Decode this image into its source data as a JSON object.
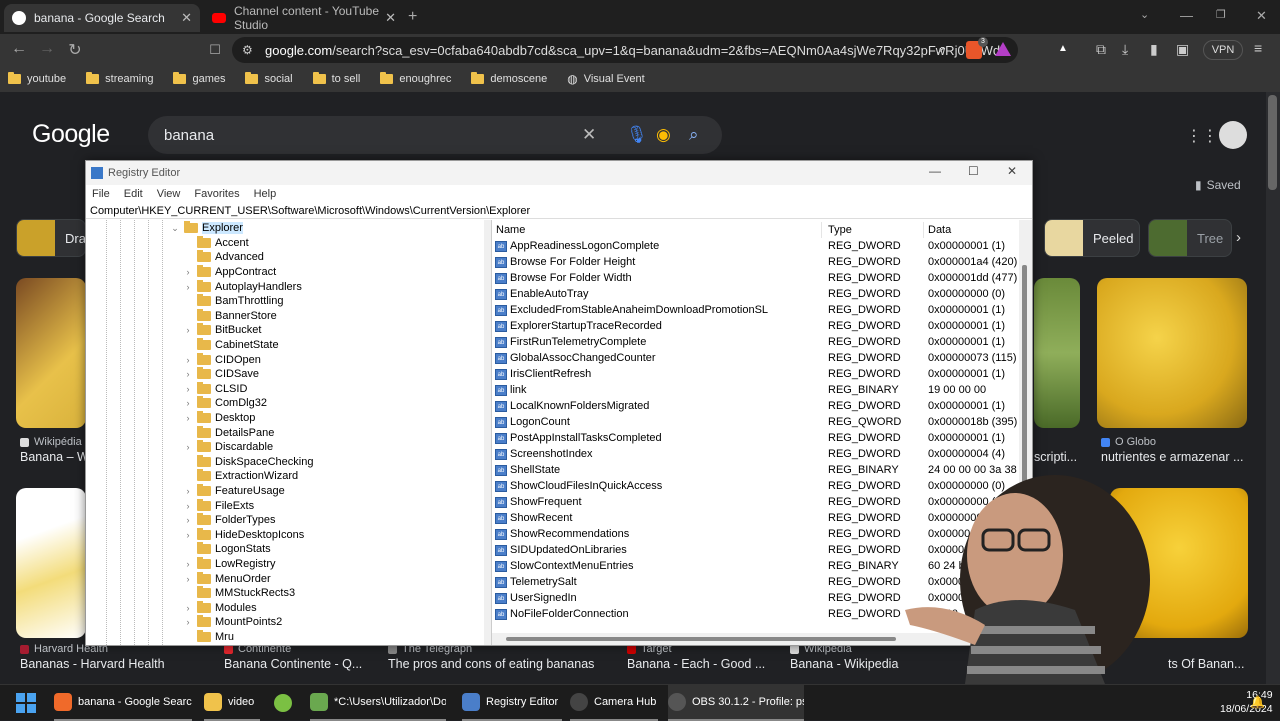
{
  "browser": {
    "tabs": [
      {
        "title": "banana - Google Search",
        "active": true,
        "color": "#ffffff"
      },
      {
        "title": "Channel content - YouTube Studio",
        "active": false,
        "color": "#ff0000"
      }
    ],
    "url_host": "google.com",
    "url_rest": "/search?sca_esv=0cfaba640abdb7cd&sca_upv=1&q=banana&udm=2&fbs=AEQNm0Aa4sjWe7Rqy32pFwRj0UkWd...",
    "brave_badge": "3",
    "vpn": "VPN",
    "bookmarks": [
      "youtube",
      "streaming",
      "games",
      "social",
      "to sell",
      "enoughrec",
      "demoscene",
      "Visual Event"
    ]
  },
  "google": {
    "logo": "Google",
    "query": "banana",
    "saved": "Saved",
    "chips": [
      "Dra",
      "Peeled",
      "Tree"
    ],
    "results": [
      {
        "source": "Wikipédia",
        "title": "Banana – W",
        "color": "#8b5a2b"
      },
      {
        "source": "O Globo",
        "title": "nutrientes e armazenar ...",
        "color": "#caa12a"
      },
      {
        "source": "",
        "title": "scripti...",
        "color": "#6a8a3a"
      },
      {
        "source": "Harvard Health",
        "title": "Bananas - Harvard Health"
      },
      {
        "source": "Continente",
        "title": "Banana Continente - Q..."
      },
      {
        "source": "The Telegraph",
        "title": "The pros and cons of eating bananas"
      },
      {
        "source": "Target",
        "title": "Banana - Each - Good ..."
      },
      {
        "source": "Wikipedia",
        "title": "Banana - Wikipedia"
      },
      {
        "source": "",
        "title": "ts Of Banan..."
      }
    ]
  },
  "regedit": {
    "title": "Registry Editor",
    "menu": [
      "File",
      "Edit",
      "View",
      "Favorites",
      "Help"
    ],
    "address": "Computer\\HKEY_CURRENT_USER\\Software\\Microsoft\\Windows\\CurrentVersion\\Explorer",
    "tree_root": "Explorer",
    "tree": [
      {
        "label": "Accent",
        "arrow": false
      },
      {
        "label": "Advanced",
        "arrow": false
      },
      {
        "label": "AppContract",
        "arrow": true
      },
      {
        "label": "AutoplayHandlers",
        "arrow": true
      },
      {
        "label": "BamThrottling",
        "arrow": false
      },
      {
        "label": "BannerStore",
        "arrow": false
      },
      {
        "label": "BitBucket",
        "arrow": true
      },
      {
        "label": "CabinetState",
        "arrow": false
      },
      {
        "label": "CIDOpen",
        "arrow": true
      },
      {
        "label": "CIDSave",
        "arrow": true
      },
      {
        "label": "CLSID",
        "arrow": true
      },
      {
        "label": "ComDlg32",
        "arrow": true
      },
      {
        "label": "Desktop",
        "arrow": true
      },
      {
        "label": "DetailsPane",
        "arrow": false
      },
      {
        "label": "Discardable",
        "arrow": true
      },
      {
        "label": "DiskSpaceChecking",
        "arrow": false
      },
      {
        "label": "ExtractionWizard",
        "arrow": false
      },
      {
        "label": "FeatureUsage",
        "arrow": true
      },
      {
        "label": "FileExts",
        "arrow": true
      },
      {
        "label": "FolderTypes",
        "arrow": true
      },
      {
        "label": "HideDesktopIcons",
        "arrow": true
      },
      {
        "label": "LogonStats",
        "arrow": false
      },
      {
        "label": "LowRegistry",
        "arrow": true
      },
      {
        "label": "MenuOrder",
        "arrow": true
      },
      {
        "label": "MMStuckRects3",
        "arrow": false
      },
      {
        "label": "Modules",
        "arrow": true
      },
      {
        "label": "MountPoints2",
        "arrow": true
      },
      {
        "label": "Mru",
        "arrow": false
      }
    ],
    "columns": [
      "Name",
      "Type",
      "Data"
    ],
    "values": [
      {
        "name": "AppReadinessLogonComplete",
        "type": "REG_DWORD",
        "data": "0x00000001 (1)"
      },
      {
        "name": "Browse For Folder Height",
        "type": "REG_DWORD",
        "data": "0x000001a4 (420)"
      },
      {
        "name": "Browse For Folder Width",
        "type": "REG_DWORD",
        "data": "0x000001dd (477)"
      },
      {
        "name": "EnableAutoTray",
        "type": "REG_DWORD",
        "data": "0x00000000 (0)"
      },
      {
        "name": "ExcludedFromStableAnaheimDownloadPromotionSL",
        "type": "REG_DWORD",
        "data": "0x00000001 (1)"
      },
      {
        "name": "ExplorerStartupTraceRecorded",
        "type": "REG_DWORD",
        "data": "0x00000001 (1)"
      },
      {
        "name": "FirstRunTelemetryComplete",
        "type": "REG_DWORD",
        "data": "0x00000001 (1)"
      },
      {
        "name": "GlobalAssocChangedCounter",
        "type": "REG_DWORD",
        "data": "0x00000073 (115)"
      },
      {
        "name": "IrisClientRefresh",
        "type": "REG_DWORD",
        "data": "0x00000001 (1)"
      },
      {
        "name": "link",
        "type": "REG_BINARY",
        "data": "19 00 00 00"
      },
      {
        "name": "LocalKnownFoldersMigrated",
        "type": "REG_DWORD",
        "data": "0x00000001 (1)"
      },
      {
        "name": "LogonCount",
        "type": "REG_QWORD",
        "data": "0x0000018b (395)"
      },
      {
        "name": "PostAppInstallTasksCompleted",
        "type": "REG_DWORD",
        "data": "0x00000001 (1)"
      },
      {
        "name": "ScreenshotIndex",
        "type": "REG_DWORD",
        "data": "0x00000004 (4)"
      },
      {
        "name": "ShellState",
        "type": "REG_BINARY",
        "data": "24 00 00 00 3a 38 00"
      },
      {
        "name": "ShowCloudFilesInQuickAccess",
        "type": "REG_DWORD",
        "data": "0x00000000 (0)"
      },
      {
        "name": "ShowFrequent",
        "type": "REG_DWORD",
        "data": "0x00000000 (0)"
      },
      {
        "name": "ShowRecent",
        "type": "REG_DWORD",
        "data": "0x00000000 (0)"
      },
      {
        "name": "ShowRecommendations",
        "type": "REG_DWORD",
        "data": "0x00000000 (0)"
      },
      {
        "name": "SIDUpdatedOnLibraries",
        "type": "REG_DWORD",
        "data": "0x00000001 (1)"
      },
      {
        "name": "SlowContextMenuEntries",
        "type": "REG_BINARY",
        "data": "60 24 b2 21 ea 3a"
      },
      {
        "name": "TelemetrySalt",
        "type": "REG_DWORD",
        "data": "0x0000000"
      },
      {
        "name": "UserSignedIn",
        "type": "REG_DWORD",
        "data": "0x0000000"
      },
      {
        "name": "NoFileFolderConnection",
        "type": "REG_DWORD",
        "data": "0x000"
      }
    ]
  },
  "taskbar": {
    "items": [
      {
        "label": "banana - Google Search",
        "color": "#f06a2a"
      },
      {
        "label": "video",
        "color": "#f0c24b"
      },
      {
        "label": "",
        "color": "#7bc043"
      },
      {
        "label": "*C:\\Users\\Utilizador\\Do",
        "color": "#6aa84f"
      },
      {
        "label": "Registry Editor",
        "color": "#4a7ec9"
      },
      {
        "label": "Camera Hub",
        "color": "#444444"
      },
      {
        "label": "OBS 30.1.2 - Profile: pse",
        "color": "#333333"
      }
    ],
    "time": "16:49",
    "date": "18/06/2024"
  }
}
